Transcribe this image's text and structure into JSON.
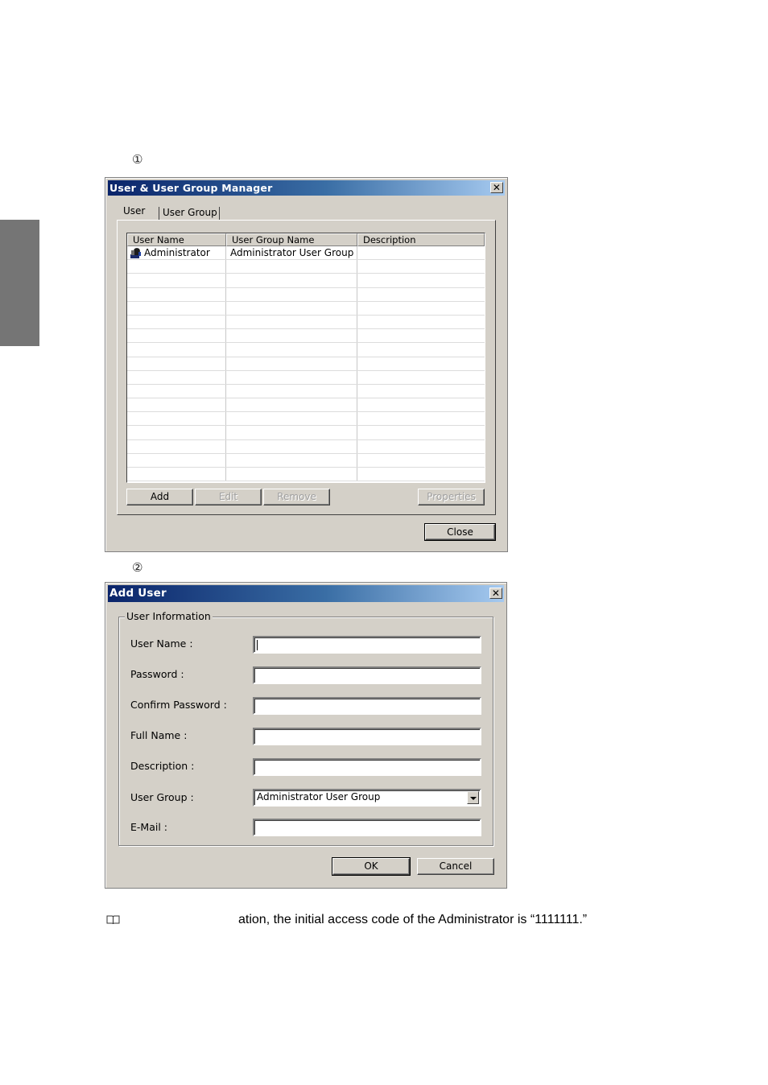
{
  "steps": {
    "one": "①",
    "two": "②"
  },
  "manager_dialog": {
    "title": "User & User Group Manager",
    "close_glyph": "✕",
    "tabs": [
      {
        "label": "User",
        "active": true
      },
      {
        "label": "User Group",
        "active": false
      }
    ],
    "columns": [
      "User Name",
      "User Group Name",
      "Description"
    ],
    "rows": [
      {
        "user_name": "Administrator",
        "user_group_name": "Administrator User Group",
        "description": "",
        "icon": "admin-user-icon"
      }
    ],
    "empty_row_count": 16,
    "buttons": {
      "add": "Add",
      "edit": "Edit",
      "remove": "Remove",
      "properties": "Properties",
      "close": "Close"
    }
  },
  "add_user_dialog": {
    "title": "Add User",
    "close_glyph": "✕",
    "group_title": "User Information",
    "fields": {
      "user_name": {
        "label": "User Name :",
        "value": ""
      },
      "password": {
        "label": "Password :",
        "value": ""
      },
      "confirm_password": {
        "label": "Confirm Password :",
        "value": ""
      },
      "full_name": {
        "label": "Full Name :",
        "value": ""
      },
      "description": {
        "label": "Description :",
        "value": ""
      },
      "user_group": {
        "label": "User Group :",
        "value": "Administrator User Group"
      },
      "email": {
        "label": "E-Mail :",
        "value": ""
      }
    },
    "buttons": {
      "ok": "OK",
      "cancel": "Cancel"
    }
  },
  "note": {
    "icon": "book-icon",
    "text": "ation, the initial access code of the Administrator is “1111111.”"
  }
}
